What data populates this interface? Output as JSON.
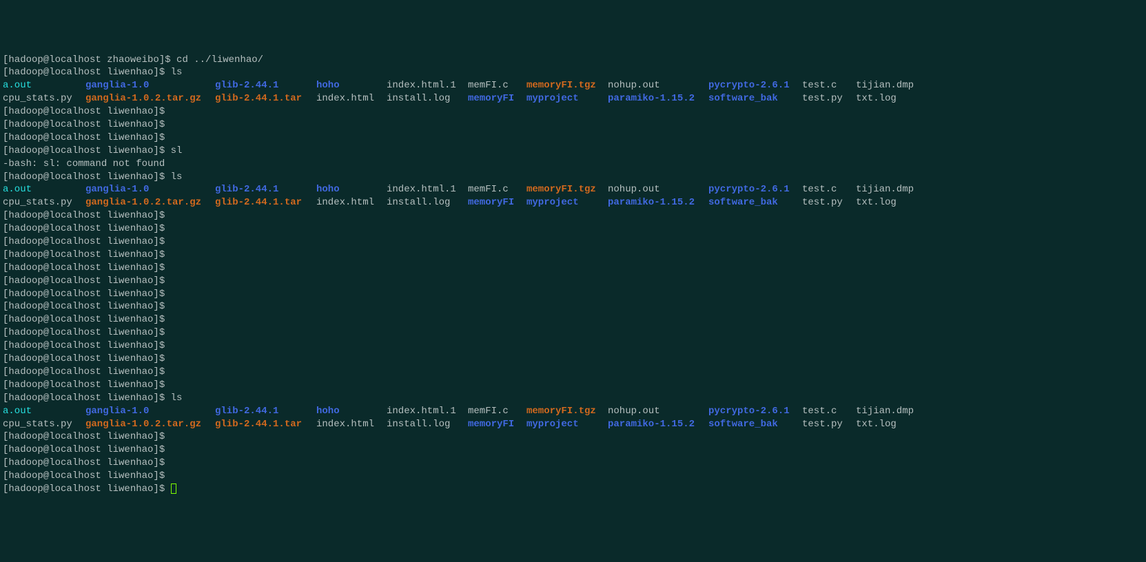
{
  "prompt_zhaoweibo": "[hadoop@localhost zhaoweibo]$ ",
  "prompt": "[hadoop@localhost liwenhao]$",
  "prompt_sp": "[hadoop@localhost liwenhao]$ ",
  "cmd_cd": "cd ../liwenhao/",
  "cmd_ls": "ls",
  "cmd_sl": "sl",
  "err_sl": "-bash: sl: command not found",
  "ls_row1": [
    {
      "text": "a.out",
      "class": "cyan"
    },
    {
      "text": "ganglia-1.0",
      "class": "blue"
    },
    {
      "text": "glib-2.44.1",
      "class": "blue"
    },
    {
      "text": "hoho",
      "class": "blue"
    },
    {
      "text": "index.html.1",
      "class": "default"
    },
    {
      "text": "memFI.c",
      "class": "default"
    },
    {
      "text": "memoryFI.tgz",
      "class": "orange"
    },
    {
      "text": "nohup.out",
      "class": "default"
    },
    {
      "text": "pycrypto-2.6.1",
      "class": "blue"
    },
    {
      "text": "test.c",
      "class": "default"
    },
    {
      "text": "tijian.dmp",
      "class": "default"
    }
  ],
  "ls_row2": [
    {
      "text": "cpu_stats.py",
      "class": "default"
    },
    {
      "text": "ganglia-1.0.2.tar.gz",
      "class": "orange"
    },
    {
      "text": "glib-2.44.1.tar",
      "class": "orange"
    },
    {
      "text": "index.html",
      "class": "default"
    },
    {
      "text": "install.log",
      "class": "default"
    },
    {
      "text": "memoryFI",
      "class": "blue"
    },
    {
      "text": "myproject",
      "class": "blue"
    },
    {
      "text": "paramiko-1.15.2",
      "class": "blue"
    },
    {
      "text": "software_bak",
      "class": "blue"
    },
    {
      "text": "test.py",
      "class": "default"
    },
    {
      "text": "txt.log",
      "class": "default"
    }
  ]
}
